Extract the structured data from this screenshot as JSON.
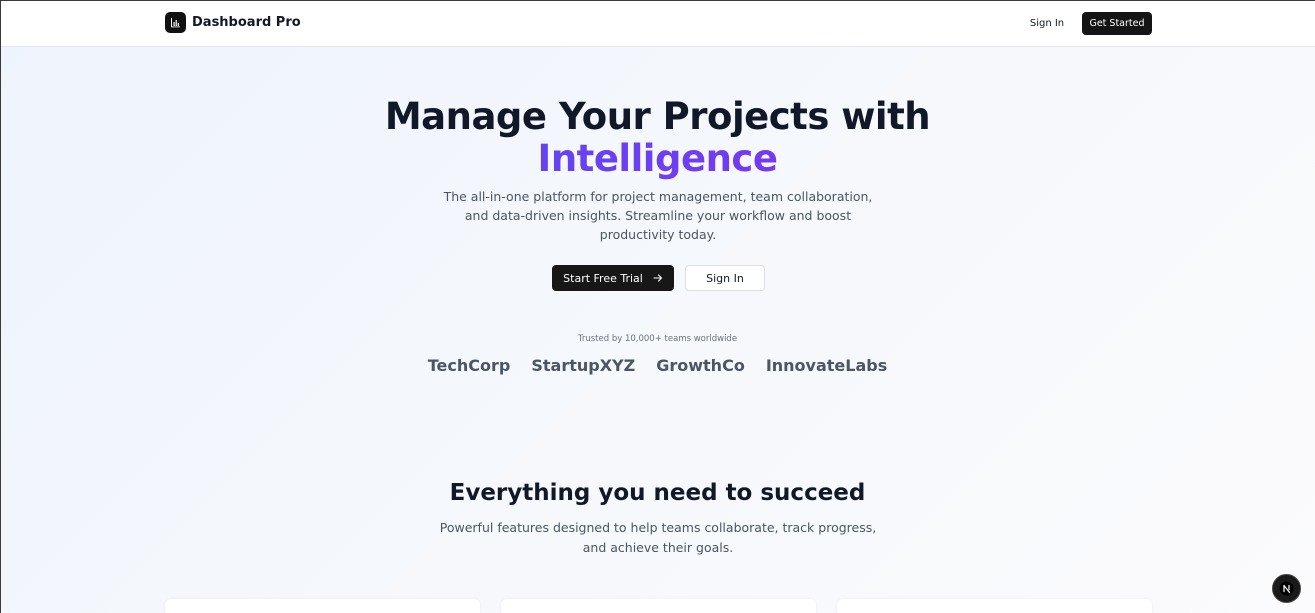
{
  "header": {
    "brand_name": "Dashboard Pro",
    "brand_icon": "bar-chart-icon",
    "sign_in_label": "Sign In",
    "get_started_label": "Get Started"
  },
  "hero": {
    "title_line1": "Manage Your Projects with",
    "title_line2": "Intelligence",
    "subtitle": "The all-in-one platform for project management, team collaboration, and data-driven insights. Streamline your workflow and boost productivity today.",
    "primary_button_label": "Start Free Trial",
    "primary_button_icon": "arrow-right-icon",
    "secondary_button_label": "Sign In",
    "gradient_colors": [
      "#3b5bea",
      "#6d3ff0",
      "#a11be6"
    ]
  },
  "trusted": {
    "text": "Trusted by 10,000+ teams worldwide",
    "logos": [
      "TechCorp",
      "StartupXYZ",
      "GrowthCo",
      "InnovateLabs"
    ]
  },
  "features": {
    "title": "Everything you need to succeed",
    "subtitle": "Powerful features designed to help teams collaborate, track progress, and achieve their goals."
  },
  "overlay": {
    "badge_icon": "nextjs-icon",
    "badge_letter": "N"
  }
}
